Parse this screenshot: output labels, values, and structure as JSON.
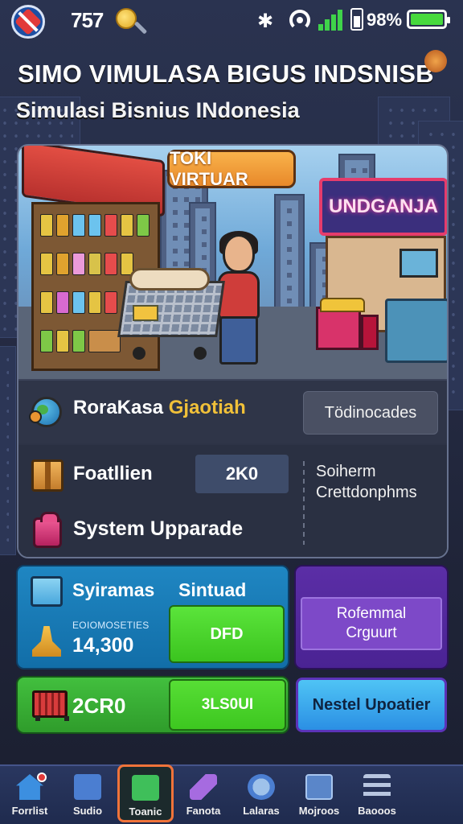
{
  "status_bar": {
    "number": "757",
    "battery_text": "98%",
    "battery_level": 1.0,
    "icons": [
      "app-badge-icon",
      "coin-icon",
      "bluetooth-icon",
      "wifi-icon",
      "signal-icon",
      "battery-icon"
    ]
  },
  "header": {
    "title": "SIMO VIMULASA BIGUS INDSNISB",
    "subtitle": "Simulasi Bisnius INdonesia"
  },
  "scene": {
    "shop_sign": "TOKI VIRTUAR",
    "stall_sign": "UNDGANJA"
  },
  "stats": {
    "row1_label": "RoraKasa",
    "row1_label_accent": "Gjaotiah",
    "row1_button": "Tödinocades",
    "row2_label": "Foatllien",
    "row2_value": "2K0",
    "row2_side_line1": "Soiherm",
    "row2_side_line2": "Crettdonphms",
    "row3_label": "System Upparade"
  },
  "cards": {
    "blue_title": "Syiramas",
    "blue_title2": "Sintuad",
    "blue_small": "EOIOMOSETIES",
    "blue_amount": "14,300",
    "blue_button": "DFD",
    "purple_line1": "Rofemmal",
    "purple_line2": "Crguurt",
    "green_value": "2CR0",
    "green_button": "3LS0UI",
    "cyan_button": "Nestel Upoatier"
  },
  "nav": {
    "items": [
      {
        "label": "Forrlist",
        "icon": "home-icon"
      },
      {
        "label": "Sudio",
        "icon": "music-icon"
      },
      {
        "label": "Toanic",
        "icon": "tools-icon"
      },
      {
        "label": "Fanota",
        "icon": "pencil-icon"
      },
      {
        "label": "Lalaras",
        "icon": "chart-icon"
      },
      {
        "label": "Mojroos",
        "icon": "photo-icon"
      },
      {
        "label": "Baooos",
        "icon": "menu-icon"
      }
    ],
    "active_index": 2
  },
  "colors": {
    "accent_orange": "#f0733a",
    "green_button": "#3bc41f",
    "blue_card": "#1f86c2",
    "purple_card": "#5b2ea6",
    "cyan_button": "#4fc4f5"
  }
}
